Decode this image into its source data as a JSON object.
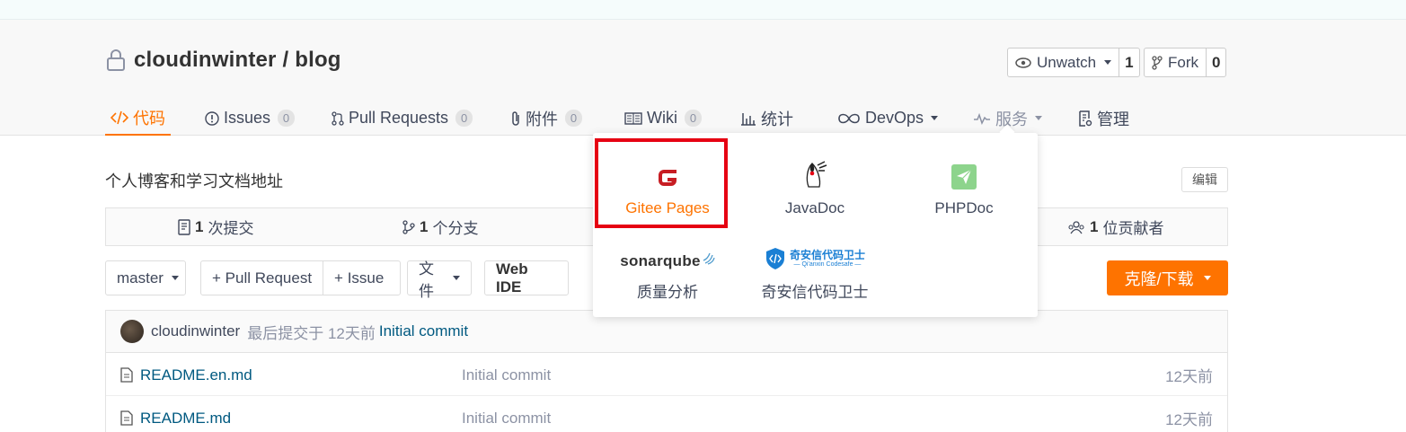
{
  "repo": {
    "owner": "cloudinwinter",
    "separator": " / ",
    "name": "blog"
  },
  "watch": {
    "label": "Unwatch",
    "count": "1"
  },
  "fork": {
    "label": "Fork",
    "count": "0"
  },
  "tabs": [
    {
      "label": "代码"
    },
    {
      "label": "Issues",
      "badge": "0"
    },
    {
      "label": "Pull Requests",
      "badge": "0"
    },
    {
      "label": "附件",
      "badge": "0"
    },
    {
      "label": "Wiki",
      "badge": "0"
    },
    {
      "label": "统计"
    },
    {
      "label": "DevOps"
    },
    {
      "label": "服务"
    },
    {
      "label": "管理"
    }
  ],
  "description": "个人博客和学习文档地址",
  "edit_label": "编辑",
  "stats": {
    "commits": {
      "count": "1",
      "label": "次提交"
    },
    "branches": {
      "count": "1",
      "label": "个分支"
    },
    "contributors": {
      "count": "1",
      "label": "位贡献者"
    }
  },
  "toolbar": {
    "branch": "master",
    "pull_request": "+ Pull Request",
    "issue": "+ Issue",
    "file": "文件",
    "web_ide": "Web IDE",
    "clone": "克隆/下载"
  },
  "commit": {
    "user": "cloudinwinter",
    "meta": "最后提交于 12天前",
    "message": "Initial commit"
  },
  "files": [
    {
      "name": "README.en.md",
      "commit": "Initial commit",
      "time": "12天前"
    },
    {
      "name": "README.md",
      "commit": "Initial commit",
      "time": "12天前"
    }
  ],
  "services": [
    {
      "label": "Gitee Pages",
      "icon": "gitee-pages-icon"
    },
    {
      "label": "JavaDoc",
      "icon": "java-duke-icon"
    },
    {
      "label": "PHPDoc",
      "icon": "phpdoc-icon"
    },
    {
      "label": "质量分析",
      "icon": "sonarqube-logo",
      "logo_text": "sonarqube"
    },
    {
      "label": "奇安信代码卫士",
      "icon": "qianxin-codesafe-logo",
      "logo_text": "奇安信代码卫士",
      "logo_subtext": "— Qi'anxin Codesafe —"
    }
  ],
  "colors": {
    "accent": "#fe7300",
    "link": "#005980",
    "highlight": "#e60012",
    "phpdoc": "#8dd48c"
  }
}
